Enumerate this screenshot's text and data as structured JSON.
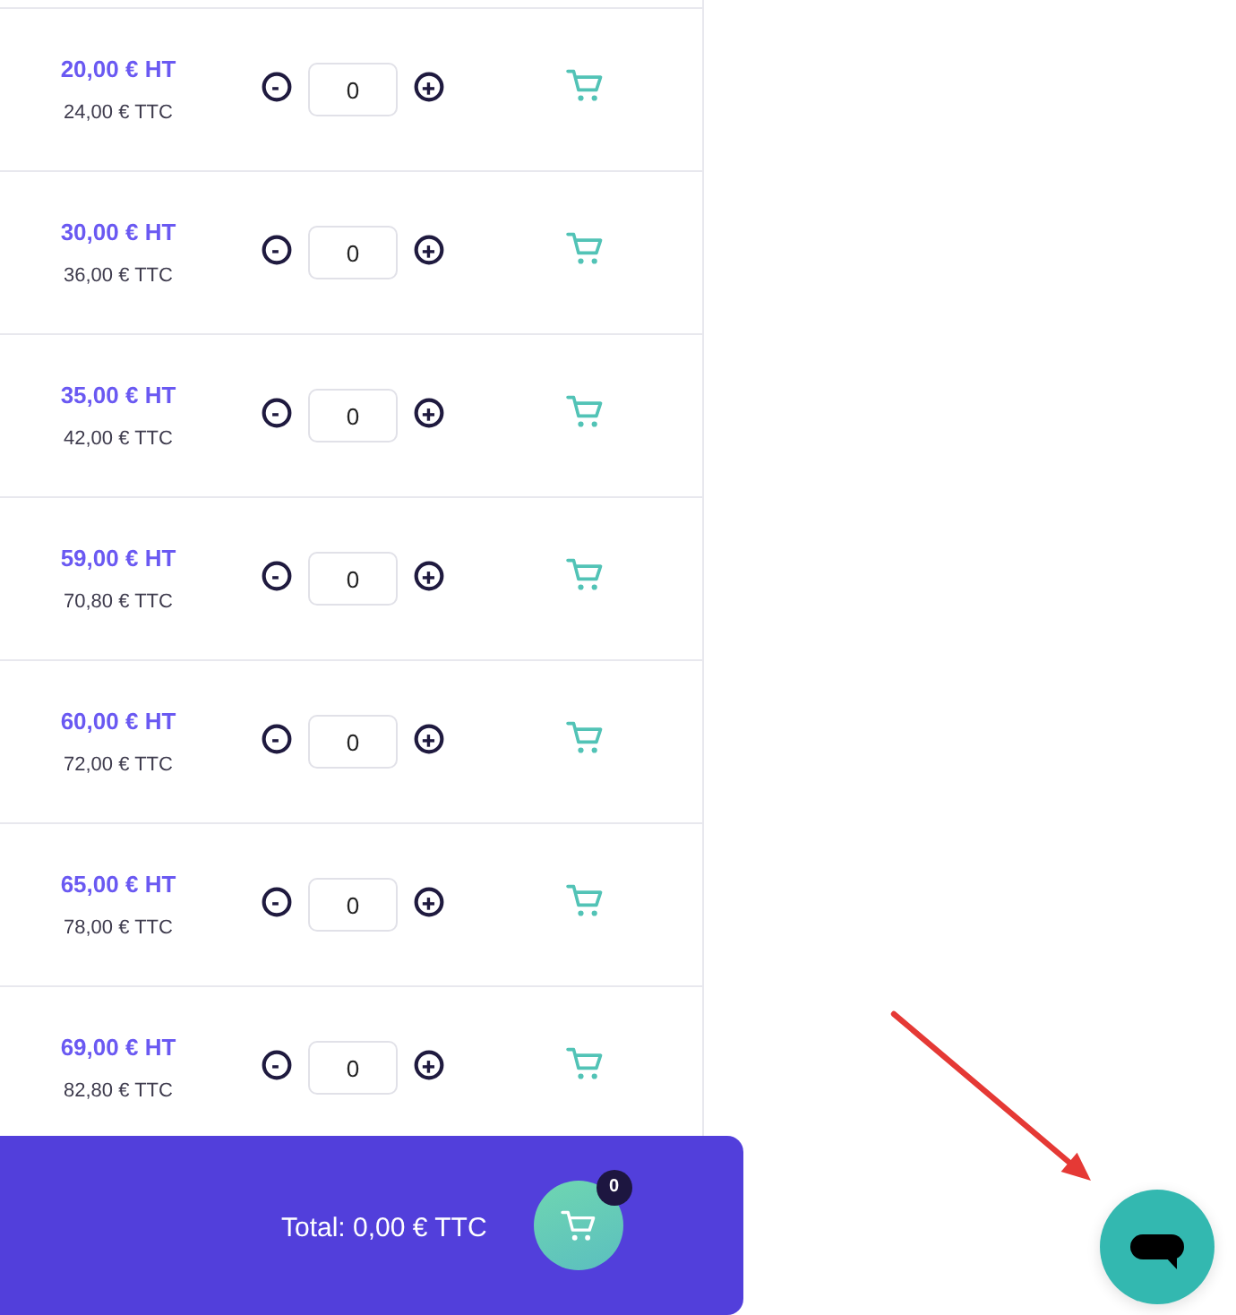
{
  "products": [
    {
      "price_ht": "20,00 € HT",
      "price_ttc": "24,00 € TTC",
      "quantity": "0"
    },
    {
      "price_ht": "30,00 € HT",
      "price_ttc": "36,00 € TTC",
      "quantity": "0"
    },
    {
      "price_ht": "35,00 € HT",
      "price_ttc": "42,00 € TTC",
      "quantity": "0"
    },
    {
      "price_ht": "59,00 € HT",
      "price_ttc": "70,80 € TTC",
      "quantity": "0"
    },
    {
      "price_ht": "60,00 € HT",
      "price_ttc": "72,00 € TTC",
      "quantity": "0"
    },
    {
      "price_ht": "65,00 € HT",
      "price_ttc": "78,00 € TTC",
      "quantity": "0"
    },
    {
      "price_ht": "69,00 € HT",
      "price_ttc": "82,80 € TTC",
      "quantity": "0"
    }
  ],
  "cart_bar": {
    "total": "Total: 0,00 € TTC",
    "count": "0"
  }
}
